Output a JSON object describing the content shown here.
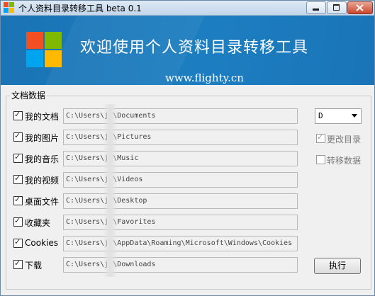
{
  "window": {
    "title": "个人资料目录转移工具 beta 0.1"
  },
  "colors": {
    "banner": "#1a73b4",
    "logo_red": "#f25022",
    "logo_green": "#7fba00",
    "logo_blue": "#00a4ef",
    "logo_yellow": "#ffb900"
  },
  "banner": {
    "title": "欢迎使用个人资料目录转移工具",
    "url": "www.flighty.cn"
  },
  "group": {
    "legend": "文档数据"
  },
  "rows": [
    {
      "label": "我的文档",
      "checked": true,
      "path": "C:\\Users\\j  \\Documents"
    },
    {
      "label": "我的图片",
      "checked": true,
      "path": "C:\\Users\\j  \\Pictures"
    },
    {
      "label": "我的音乐",
      "checked": true,
      "path": "C:\\Users\\j  \\Music"
    },
    {
      "label": "我的视频",
      "checked": true,
      "path": "C:\\Users\\j  \\Videos"
    },
    {
      "label": "桌面文件",
      "checked": true,
      "path": "C:\\Users\\j  \\Desktop"
    },
    {
      "label": "收藏夹",
      "checked": true,
      "path": "C:\\Users\\j  \\Favorites"
    },
    {
      "label": "Cookies",
      "checked": true,
      "path": "C:\\Users\\j  \\AppData\\Roaming\\Microsoft\\Windows\\Cookies"
    },
    {
      "label": "下载",
      "checked": true,
      "path": "C:\\Users\\j  \\Downloads"
    }
  ],
  "drive": {
    "selected": "D"
  },
  "options": {
    "change_dir": {
      "label": "更改目录",
      "checked": true,
      "enabled": false
    },
    "move_data": {
      "label": "转移数据",
      "checked": false,
      "enabled": false
    }
  },
  "actions": {
    "execute": "执行"
  }
}
